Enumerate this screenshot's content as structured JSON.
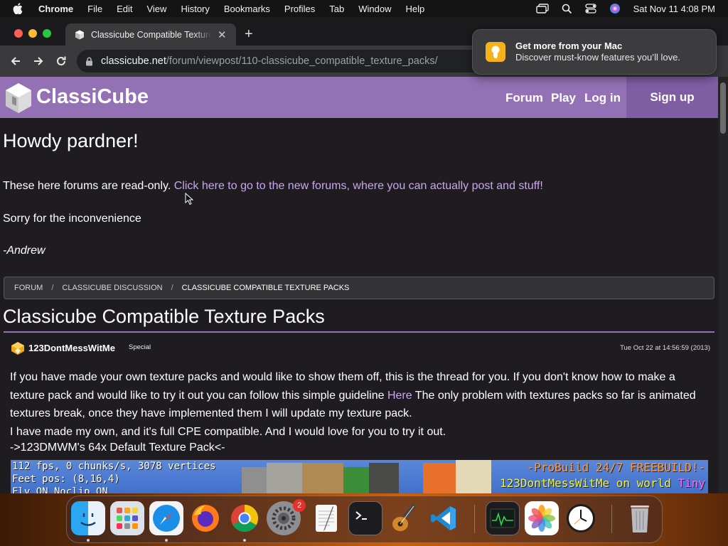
{
  "menubar": {
    "app": "Chrome",
    "items": [
      "File",
      "Edit",
      "View",
      "History",
      "Bookmarks",
      "Profiles",
      "Tab",
      "Window",
      "Help"
    ],
    "clock": "Sat Nov 11  4:08 PM"
  },
  "browser": {
    "tab_title": "Classicube Compatible Texture Packs",
    "url_host": "classicube.net",
    "url_path": "/forum/viewpost/110-classicube_compatible_texture_packs/"
  },
  "notification": {
    "title": "Get more from your Mac",
    "body": "Discover must-know features you’ll love."
  },
  "site": {
    "name": "ClassiCube",
    "nav": {
      "forum": "Forum",
      "play": "Play",
      "login": "Log in",
      "signup": "Sign up"
    },
    "brand_color": "#9471b5"
  },
  "notice": {
    "heading": "Howdy pardner!",
    "text": "These here forums are read-only.",
    "link": "Click here to go to the new forums, where you can actually post and stuff!",
    "sorry": "Sorry for the inconvenience",
    "signature": "-Andrew"
  },
  "breadcrumb": [
    "FORUM",
    "CLASSICUBE DISCUSSION",
    "CLASSICUBE COMPATIBLE TEXTURE PACKS"
  ],
  "thread": {
    "title": "Classicube Compatible Texture Packs",
    "author": "123DontMessWitMe",
    "rank": "Special",
    "timestamp": "Tue Oct 22 at 14:56:59 (2013)",
    "body_1": "If you have made your own texture packs and would like to show them off, this is the thread for you. If you don't know how to make a texture pack and would like to try it out you can follow this simple guideline",
    "body_link": "Here",
    "body_2": "The only problem with textures packs so far is animated textures break, once they have implemented them I will update my texture pack.",
    "body_3": "I have made my own, and it's full CPE compatible. And I would love for you to try it out.",
    "pack_link": "->123DMWM's 64x Default Texture Pack<-",
    "screenshot": {
      "hud_1": "112 fps, 0 chunks/s, 3078 vertices",
      "hud_2": "Feet pos: (8,16,4)",
      "hud_3": "Fly ON  Noclip ON",
      "server_1": "-ProBuild 24/7 FREEBUILD!-",
      "server_2_a": "123DontMessWitMe on world ",
      "server_2_b": "Tiny"
    }
  },
  "dock": {
    "apps": [
      "Finder",
      "Launchpad",
      "Safari",
      "Firefox",
      "Chrome",
      "System Settings",
      "TextEdit",
      "Terminal",
      "GarageBand",
      "Visual Studio Code",
      "Activity Monitor",
      "Photos",
      "Clock",
      "Trash"
    ],
    "settings_badge": "2"
  }
}
